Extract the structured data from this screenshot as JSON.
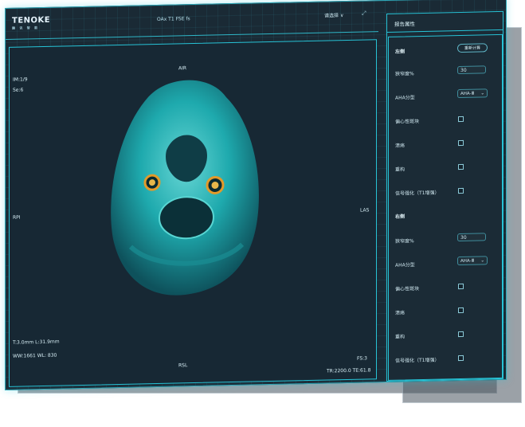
{
  "app": {
    "logo": "TENOKE",
    "logo_sub": "腾 讯 智 能",
    "series_title": "OAx T1 FSE fs",
    "select_label": "请选择",
    "select_caret": "∨",
    "expand_icon": "⤢"
  },
  "viewer": {
    "img": "IM:1/9",
    "se": "Se:6",
    "top": "AIR",
    "left": "RPI",
    "right": "LAS",
    "bottom": "RSL",
    "thickness": "T:3.0mm L:31.9mm",
    "window": "WW:1661 WL: 830",
    "fs": "FS:3",
    "tr_te": "TR:2200.0 TE:61.8"
  },
  "sidebar": {
    "title": "报告属性",
    "recalc": "重新计算",
    "left": {
      "header": "左侧",
      "stenosis_label": "狭窄度%",
      "stenosis_value": "30",
      "aha_label": "AHA分型",
      "aha_value": "AHA-Ⅲ",
      "eccentric": "偏心性斑块",
      "ulcer": "溃疡",
      "remodel": "重构",
      "signal": "信号强化（T1增强）"
    },
    "right": {
      "header": "右侧",
      "stenosis_label": "狭窄度%",
      "stenosis_value": "30",
      "aha_label": "AHA分型",
      "aha_value": "AHA-Ⅲ",
      "eccentric": "偏心性斑块",
      "ulcer": "溃疡",
      "remodel": "重构",
      "signal": "信号强化（T1增强）"
    }
  },
  "colors": {
    "accent": "#27c3d6",
    "background": "#1a2a35",
    "scan": "#2ad0cf",
    "vessel_ring": "#e29a2a"
  }
}
